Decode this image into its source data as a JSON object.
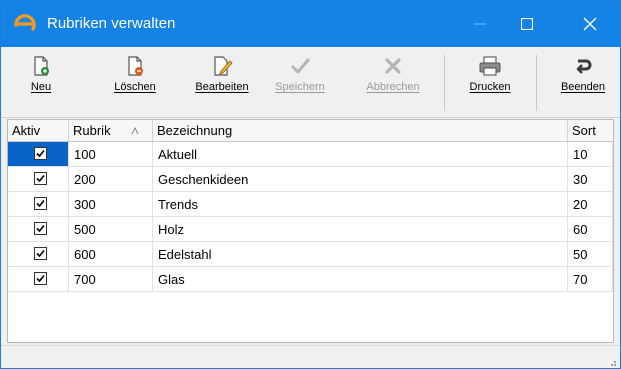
{
  "window": {
    "title": "Rubriken verwalten",
    "accent": "#1583e6"
  },
  "toolbar": {
    "items": [
      {
        "label": "Neu",
        "icon": "new-document-icon",
        "enabled": true
      },
      {
        "label": "Löschen",
        "icon": "delete-document-icon",
        "enabled": true
      },
      {
        "label": "Bearbeiten",
        "icon": "edit-document-icon",
        "enabled": true
      },
      {
        "label": "Speichern",
        "icon": "checkmark-icon",
        "enabled": false
      },
      {
        "label": "Abbrechen",
        "icon": "x-icon",
        "enabled": false
      },
      {
        "label": "Drucken",
        "icon": "printer-icon",
        "enabled": true
      },
      {
        "label": "Beenden",
        "icon": "exit-icon",
        "enabled": true
      }
    ]
  },
  "grid": {
    "columns": {
      "aktiv": "Aktiv",
      "rubrik": "Rubrik",
      "bezeichnung": "Bezeichnung",
      "sort": "Sort"
    },
    "rows": [
      {
        "aktiv": true,
        "rubrik": "100",
        "bezeichnung": "Aktuell",
        "sort": "10",
        "selected": true
      },
      {
        "aktiv": true,
        "rubrik": "200",
        "bezeichnung": "Geschenkideen",
        "sort": "30",
        "selected": false
      },
      {
        "aktiv": true,
        "rubrik": "300",
        "bezeichnung": "Trends",
        "sort": "20",
        "selected": false
      },
      {
        "aktiv": true,
        "rubrik": "500",
        "bezeichnung": "Holz",
        "sort": "60",
        "selected": false
      },
      {
        "aktiv": true,
        "rubrik": "600",
        "bezeichnung": "Edelstahl",
        "sort": "50",
        "selected": false
      },
      {
        "aktiv": true,
        "rubrik": "700",
        "bezeichnung": "Glas",
        "sort": "70",
        "selected": false
      }
    ]
  }
}
